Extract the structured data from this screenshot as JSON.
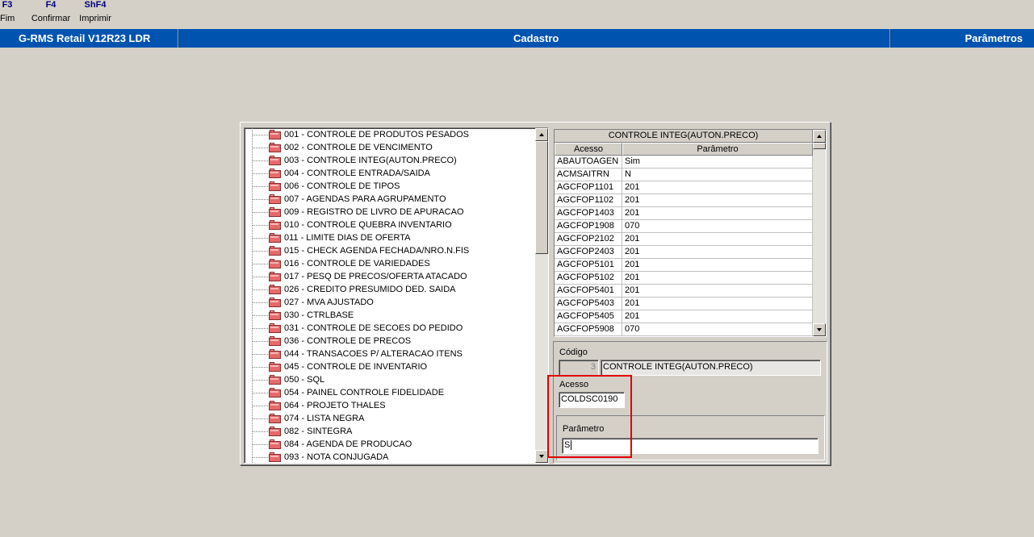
{
  "function_keys": [
    {
      "key": "F3",
      "label": "Fim"
    },
    {
      "key": "F4",
      "label": "Confirmar"
    },
    {
      "key": "ShF4",
      "label": "Imprimir"
    }
  ],
  "titlebar": {
    "app": "G-RMS Retail V12R23 LDR",
    "screen": "Cadastro",
    "section": "Parâmetros",
    "color": "#0054b0"
  },
  "tree": {
    "items": [
      "001 - CONTROLE DE PRODUTOS PESADOS",
      "002 - CONTROLE DE VENCIMENTO",
      "003 - CONTROLE INTEG(AUTON.PRECO)",
      "004 - CONTROLE ENTRADA/SAIDA",
      "006 - CONTROLE DE TIPOS",
      "007 - AGENDAS PARA AGRUPAMENTO",
      "009 - REGISTRO DE LIVRO DE APURACAO",
      "010 - CONTROLE QUEBRA INVENTARIO",
      "011 - LIMITE DIAS DE OFERTA",
      "015 - CHECK AGENDA FECHADA/NRO.N.FIS",
      "016 - CONTROLE DE VARIEDADES",
      "017 - PESQ DE PRECOS/OFERTA ATACADO",
      "026 - CREDITO PRESUMIDO DED. SAIDA",
      "027 - MVA AJUSTADO",
      "030 - CTRLBASE",
      "031 - CONTROLE DE SECOES DO PEDIDO",
      "036 - CONTROLE DE PRECOS",
      "044 - TRANSACOES P/ ALTERACAO ITENS",
      "045 - CONTROLE DE INVENTARIO",
      "050 - SQL",
      "054 - PAINEL CONTROLE FIDELIDADE",
      "064 - PROJETO THALES",
      "074 - LISTA NEGRA",
      "082 - SINTEGRA",
      "084 - AGENDA DE PRODUCAO",
      "093 - NOTA CONJUGADA"
    ],
    "folder_icon": "folder-icon"
  },
  "grid": {
    "caption": "CONTROLE INTEG(AUTON.PRECO)",
    "columns": [
      "Acesso",
      "Parâmetro"
    ],
    "rows": [
      [
        "ABAUTOAGEN",
        "Sim"
      ],
      [
        "ACMSAITRN",
        "N"
      ],
      [
        "AGCFOP1101",
        "201"
      ],
      [
        "AGCFOP1102",
        "201"
      ],
      [
        "AGCFOP1403",
        "201"
      ],
      [
        "AGCFOP1908",
        "070"
      ],
      [
        "AGCFOP2102",
        "201"
      ],
      [
        "AGCFOP2403",
        "201"
      ],
      [
        "AGCFOP5101",
        "201"
      ],
      [
        "AGCFOP5102",
        "201"
      ],
      [
        "AGCFOP5401",
        "201"
      ],
      [
        "AGCFOP5403",
        "201"
      ],
      [
        "AGCFOP5405",
        "201"
      ],
      [
        "AGCFOP5908",
        "070"
      ]
    ]
  },
  "form": {
    "codigo_label": "Código",
    "codigo_value": "3",
    "codigo_desc": "CONTROLE INTEG(AUTON.PRECO)",
    "acesso_label": "Acesso",
    "acesso_value": "COLDSC0190",
    "parametro_label": "Parâmetro",
    "parametro_value": "S"
  },
  "highlight_color": "#e00000"
}
